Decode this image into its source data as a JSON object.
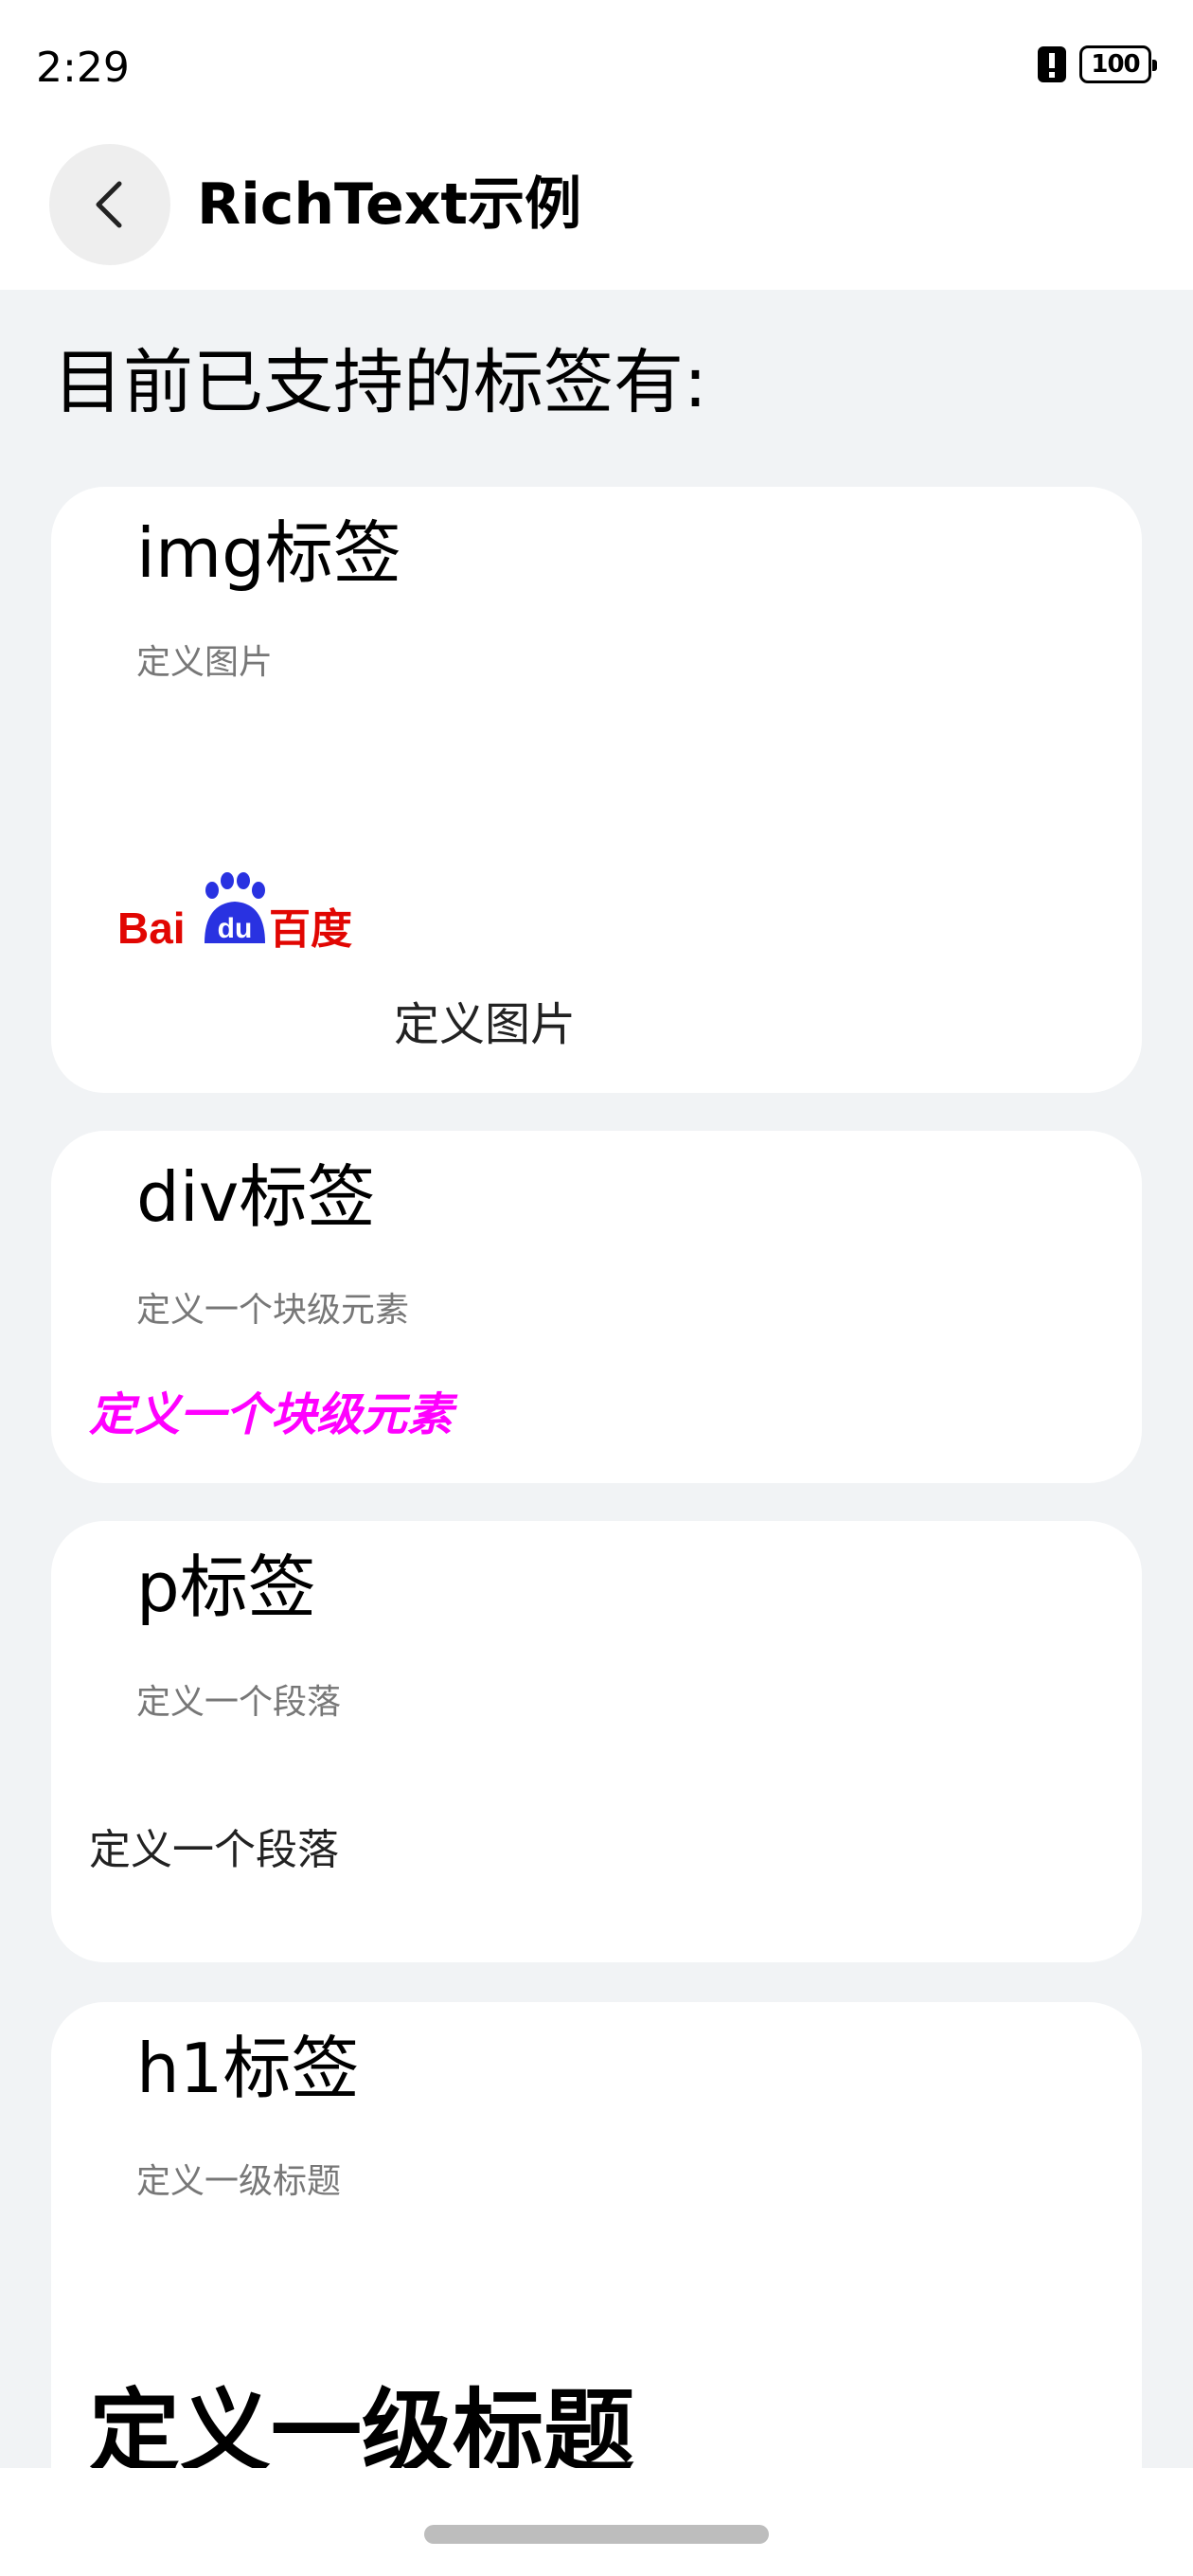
{
  "status_bar": {
    "time": "2:29",
    "battery_level": "100"
  },
  "header": {
    "title": "RichText示例",
    "back_icon": "chevron-left-icon"
  },
  "main": {
    "heading": "目前已支持的标签有:",
    "cards": {
      "img": {
        "title": "img标签",
        "desc": "定义图片",
        "logo_text_left": "Bai",
        "logo_text_paw": "du",
        "logo_text_right": "百度",
        "caption": "定义图片"
      },
      "div": {
        "title": "div标签",
        "desc": "定义一个块级元素",
        "content": "定义一个块级元素"
      },
      "p": {
        "title": "p标签",
        "desc": "定义一个段落",
        "content": "定义一个段落"
      },
      "h1": {
        "title": "h1标签",
        "desc": "定义一级标题",
        "content": "定义一级标题"
      }
    }
  },
  "colors": {
    "background": "#f1f3f5",
    "card": "#ffffff",
    "baidu_red": "#e10602",
    "baidu_blue": "#2932e1",
    "div_magenta": "#ff00ff",
    "muted_text": "#777777"
  }
}
